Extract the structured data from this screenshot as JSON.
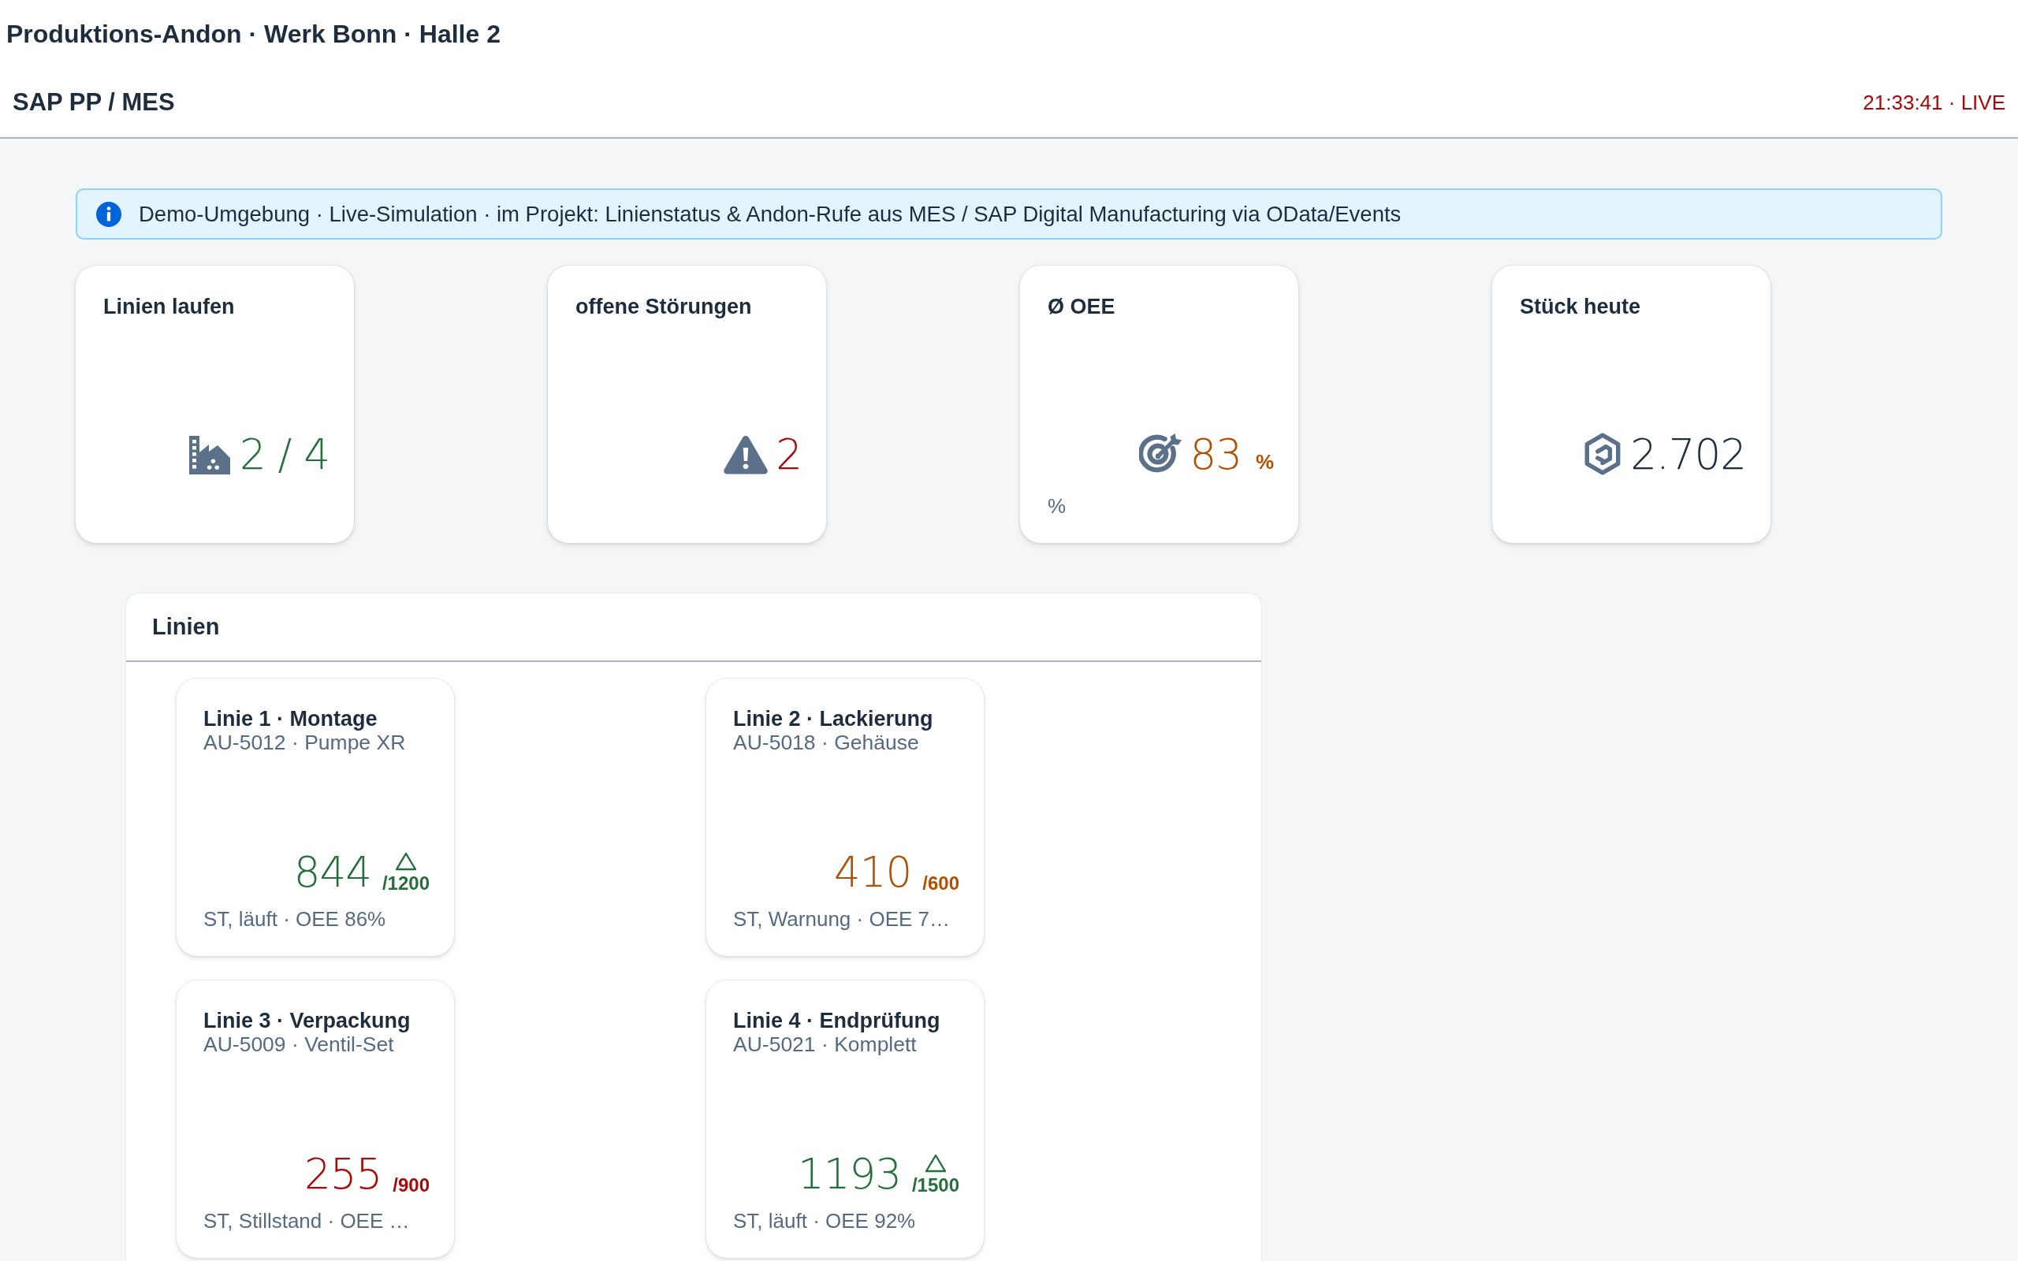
{
  "header": {
    "title": "Produktions-Andon · Werk Bonn · Halle 2",
    "subtitle": "SAP PP / MES",
    "clock": "21:33:41 · LIVE"
  },
  "info_banner": {
    "text": "Demo-Umgebung · Live-Simulation · im Projekt: Linienstatus & Andon-Rufe aus MES / SAP Digital Manufacturing via OData/Events"
  },
  "kpis": [
    {
      "title": "Linien laufen",
      "value": "2 / 4",
      "color": "#256f3a"
    },
    {
      "title": "offene Störungen",
      "value": "2",
      "color": "#aa0808"
    },
    {
      "title": "Ø OEE",
      "value": "83",
      "unit": "%",
      "color": "#b25000",
      "footnote": "%"
    },
    {
      "title": "Stück heute",
      "value": "2.702",
      "color": "#1d2d3e"
    }
  ],
  "lines_panel": {
    "title": "Linien",
    "lines": [
      {
        "title": "Linie 1 · Montage",
        "order": "AU-5012 · Pumpe XR",
        "count": "844",
        "target": "/1200",
        "color": "#256f3a",
        "trend_up": true,
        "footer": "ST, läuft · OEE 86%"
      },
      {
        "title": "Linie 2 · Lackierung",
        "order": "AU-5018 · Gehäuse",
        "count": "410",
        "target": "/600",
        "color": "#b25000",
        "trend_up": false,
        "footer": "ST, Warnung · OEE 7…"
      },
      {
        "title": "Linie 3 · Verpackung",
        "order": "AU-5009 · Ventil-Set",
        "count": "255",
        "target": "/900",
        "color": "#aa0808",
        "trend_up": false,
        "footer": "ST, Stillstand · OEE …"
      },
      {
        "title": "Linie 4 · Endprüfung",
        "order": "AU-5021 · Komplett",
        "count": "1193",
        "target": "/1500",
        "color": "#256f3a",
        "trend_up": true,
        "footer": "ST, läuft · OEE 92%"
      }
    ]
  }
}
